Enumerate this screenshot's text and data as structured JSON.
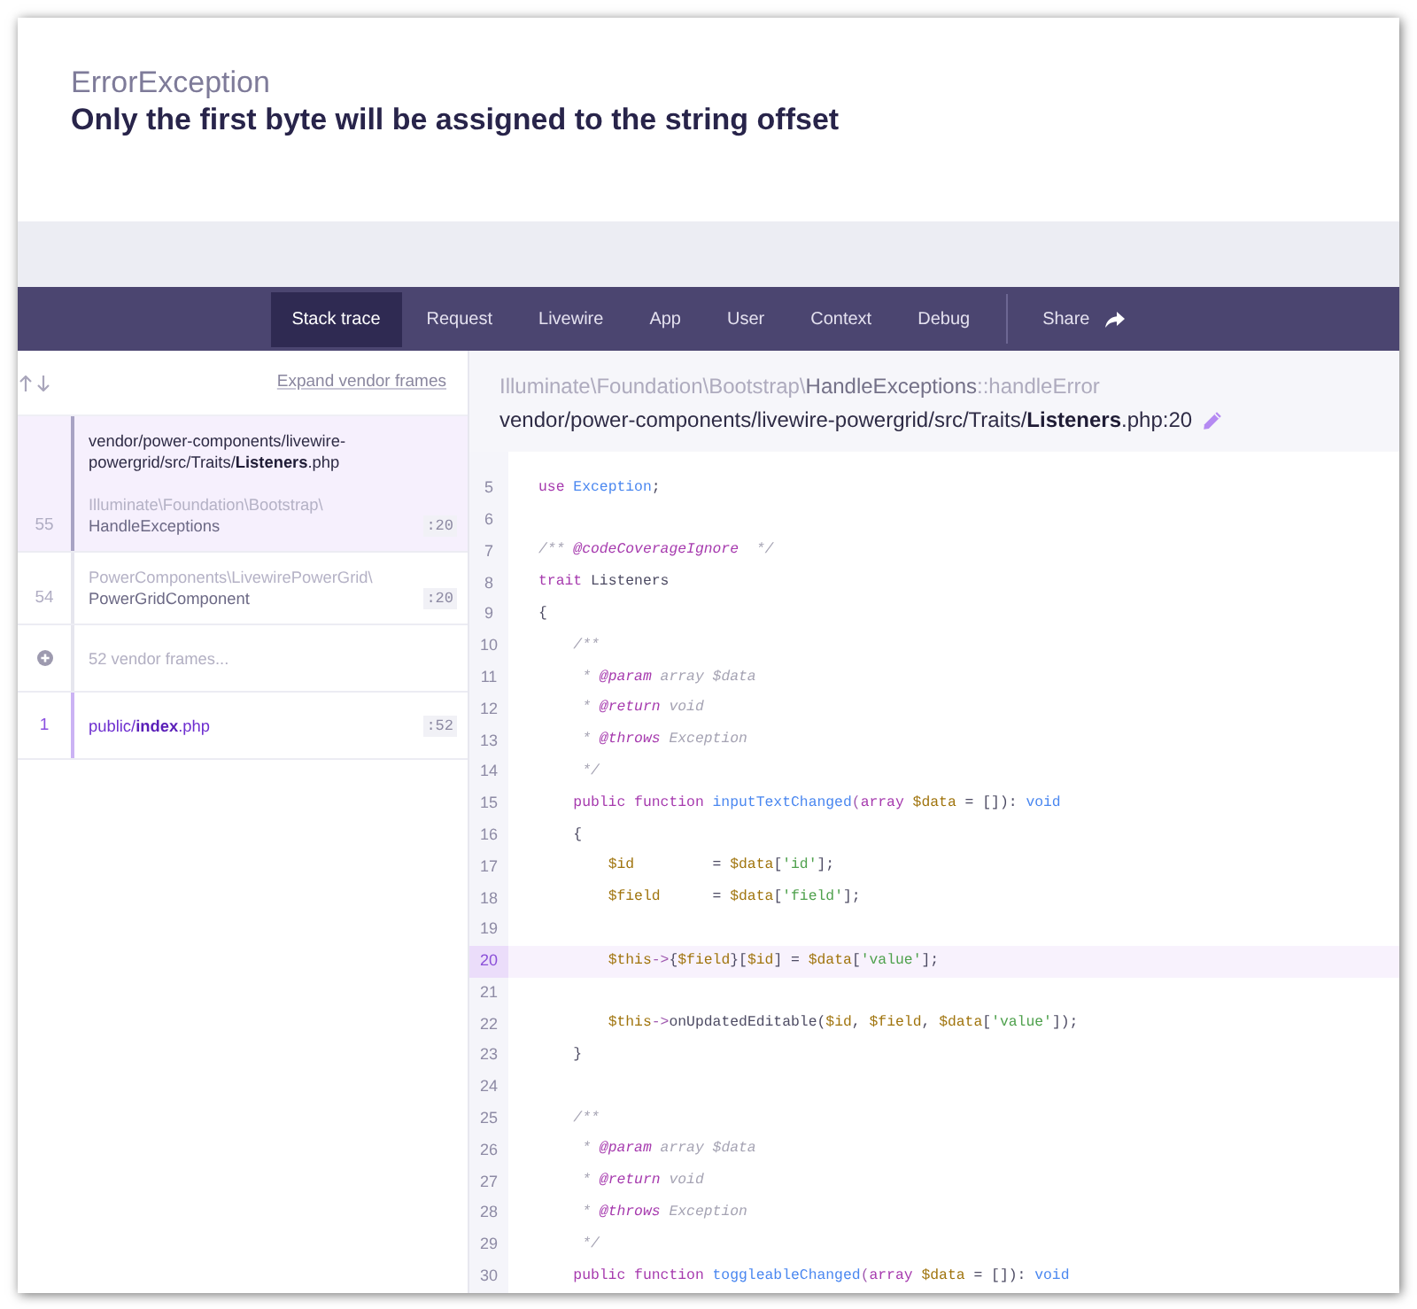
{
  "exception": {
    "class": "ErrorException",
    "message": "Only the first byte will be assigned to the string offset"
  },
  "tabs": [
    {
      "label": "Stack trace",
      "selected": true
    },
    {
      "label": "Request",
      "selected": false
    },
    {
      "label": "Livewire",
      "selected": false
    },
    {
      "label": "App",
      "selected": false
    },
    {
      "label": "User",
      "selected": false
    },
    {
      "label": "Context",
      "selected": false
    },
    {
      "label": "Debug",
      "selected": false
    }
  ],
  "share": {
    "label": "Share"
  },
  "stack": {
    "expand_link": "Expand vendor frames",
    "frames": [
      {
        "kind": "vendor",
        "selected": true,
        "number": "55",
        "file": "vendor/power-components/livewire-powergrid/src/Traits/**Listeners**.php",
        "namespace": "Illuminate\\Foundation\\Bootstrap\\",
        "class": "HandleExceptions",
        "line": ":20"
      },
      {
        "kind": "vendor",
        "selected": false,
        "number": "54",
        "namespace": "PowerComponents\\LivewirePowerGrid\\",
        "class": "PowerGridComponent",
        "line": ":20"
      },
      {
        "kind": "collapsed",
        "selected": false,
        "label": "52 vendor frames..."
      },
      {
        "kind": "application",
        "selected": false,
        "number": "1",
        "file": "public/**index**.php",
        "line": ":52"
      }
    ]
  },
  "code": {
    "namespace": "Illuminate\\Foundation\\Bootstrap\\",
    "class": "HandleExceptions",
    "method": "::handleError",
    "file": "vendor/power-components/livewire-powergrid/src/Traits/**Listeners**.php:20",
    "lines": [
      {
        "number": "5",
        "highlighted": false,
        "tokens": [
          {
            "kind": "keyword",
            "text": "use"
          },
          {
            "kind": "type",
            "text": " Exception"
          },
          {
            "kind": "plain",
            "text": ";"
          }
        ]
      },
      {
        "number": "6",
        "highlighted": false
      },
      {
        "number": "7",
        "highlighted": false,
        "tokens": [
          {
            "kind": "comment",
            "text": "/** "
          },
          {
            "kind": "doctag",
            "text": "@codeCoverageIgnore"
          },
          {
            "kind": "comment",
            "text": "  */"
          }
        ]
      },
      {
        "number": "8",
        "highlighted": false,
        "tokens": [
          {
            "kind": "keyword",
            "text": "trait"
          },
          {
            "kind": "plain",
            "text": " Listeners"
          }
        ]
      },
      {
        "number": "9",
        "highlighted": false,
        "tokens": [
          {
            "kind": "plain",
            "text": "{"
          }
        ]
      },
      {
        "number": "10",
        "highlighted": false,
        "tokens": [
          {
            "kind": "comment",
            "text": "    /**"
          }
        ]
      },
      {
        "number": "11",
        "highlighted": false,
        "tokens": [
          {
            "kind": "comment",
            "text": "     * "
          },
          {
            "kind": "doctag",
            "text": "@param"
          },
          {
            "kind": "comment",
            "text": " array $data"
          }
        ]
      },
      {
        "number": "12",
        "highlighted": false,
        "tokens": [
          {
            "kind": "comment",
            "text": "     * "
          },
          {
            "kind": "doctag",
            "text": "@return"
          },
          {
            "kind": "comment",
            "text": " void"
          }
        ]
      },
      {
        "number": "13",
        "highlighted": false,
        "tokens": [
          {
            "kind": "comment",
            "text": "     * "
          },
          {
            "kind": "doctag",
            "text": "@throws"
          },
          {
            "kind": "comment",
            "text": " Exception"
          }
        ]
      },
      {
        "number": "14",
        "highlighted": false,
        "tokens": [
          {
            "kind": "comment",
            "text": "     */"
          }
        ]
      },
      {
        "number": "15",
        "highlighted": false,
        "tokens": [
          {
            "kind": "keyword",
            "text": "    public function"
          },
          {
            "kind": "type",
            "text": " inputTextChanged"
          },
          {
            "kind": "operator",
            "text": "("
          },
          {
            "kind": "keyword",
            "text": "array"
          },
          {
            "kind": "variable",
            "text": " $data"
          },
          {
            "kind": "plain",
            "text": " = []): "
          },
          {
            "kind": "type",
            "text": "void"
          }
        ]
      },
      {
        "number": "16",
        "highlighted": false,
        "tokens": [
          {
            "kind": "plain",
            "text": "    {"
          }
        ]
      },
      {
        "number": "17",
        "highlighted": false,
        "tokens": [
          {
            "kind": "variable",
            "text": "        $id"
          },
          {
            "kind": "plain",
            "text": "         = "
          },
          {
            "kind": "variable",
            "text": "$data"
          },
          {
            "kind": "plain",
            "text": "["
          },
          {
            "kind": "string",
            "text": "'id'"
          },
          {
            "kind": "plain",
            "text": "];"
          }
        ]
      },
      {
        "number": "18",
        "highlighted": false,
        "tokens": [
          {
            "kind": "variable",
            "text": "        $field"
          },
          {
            "kind": "plain",
            "text": "      = "
          },
          {
            "kind": "variable",
            "text": "$data"
          },
          {
            "kind": "plain",
            "text": "["
          },
          {
            "kind": "string",
            "text": "'field'"
          },
          {
            "kind": "plain",
            "text": "];"
          }
        ]
      },
      {
        "number": "19",
        "highlighted": false
      },
      {
        "number": "20",
        "highlighted": true,
        "tokens": [
          {
            "kind": "variable",
            "text": "        $this"
          },
          {
            "kind": "operator",
            "text": "->"
          },
          {
            "kind": "plain",
            "text": "{"
          },
          {
            "kind": "variable",
            "text": "$field"
          },
          {
            "kind": "plain",
            "text": "}["
          },
          {
            "kind": "variable",
            "text": "$id"
          },
          {
            "kind": "plain",
            "text": "] = "
          },
          {
            "kind": "variable",
            "text": "$data"
          },
          {
            "kind": "plain",
            "text": "["
          },
          {
            "kind": "string",
            "text": "'value'"
          },
          {
            "kind": "plain",
            "text": "];"
          }
        ]
      },
      {
        "number": "21",
        "highlighted": false
      },
      {
        "number": "22",
        "highlighted": false,
        "tokens": [
          {
            "kind": "variable",
            "text": "        $this"
          },
          {
            "kind": "operator",
            "text": "->"
          },
          {
            "kind": "plain",
            "text": "onUpdatedEditable("
          },
          {
            "kind": "variable",
            "text": "$id"
          },
          {
            "kind": "plain",
            "text": ", "
          },
          {
            "kind": "variable",
            "text": "$field"
          },
          {
            "kind": "plain",
            "text": ", "
          },
          {
            "kind": "variable",
            "text": "$data"
          },
          {
            "kind": "plain",
            "text": "["
          },
          {
            "kind": "string",
            "text": "'value'"
          },
          {
            "kind": "plain",
            "text": "]);"
          }
        ]
      },
      {
        "number": "23",
        "highlighted": false,
        "tokens": [
          {
            "kind": "plain",
            "text": "    }"
          }
        ]
      },
      {
        "number": "24",
        "highlighted": false
      },
      {
        "number": "25",
        "highlighted": false,
        "tokens": [
          {
            "kind": "comment",
            "text": "    /**"
          }
        ]
      },
      {
        "number": "26",
        "highlighted": false,
        "tokens": [
          {
            "kind": "comment",
            "text": "     * "
          },
          {
            "kind": "doctag",
            "text": "@param"
          },
          {
            "kind": "comment",
            "text": " array $data"
          }
        ]
      },
      {
        "number": "27",
        "highlighted": false,
        "tokens": [
          {
            "kind": "comment",
            "text": "     * "
          },
          {
            "kind": "doctag",
            "text": "@return"
          },
          {
            "kind": "comment",
            "text": " void"
          }
        ]
      },
      {
        "number": "28",
        "highlighted": false,
        "tokens": [
          {
            "kind": "comment",
            "text": "     * "
          },
          {
            "kind": "doctag",
            "text": "@throws"
          },
          {
            "kind": "comment",
            "text": " Exception"
          }
        ]
      },
      {
        "number": "29",
        "highlighted": false,
        "tokens": [
          {
            "kind": "comment",
            "text": "     */"
          }
        ]
      },
      {
        "number": "30",
        "highlighted": false,
        "tokens": [
          {
            "kind": "keyword",
            "text": "    public function"
          },
          {
            "kind": "type",
            "text": " toggleableChanged"
          },
          {
            "kind": "operator",
            "text": "("
          },
          {
            "kind": "keyword",
            "text": "array"
          },
          {
            "kind": "variable",
            "text": " $data"
          },
          {
            "kind": "plain",
            "text": " = []): "
          },
          {
            "kind": "type",
            "text": "void"
          }
        ]
      }
    ]
  }
}
